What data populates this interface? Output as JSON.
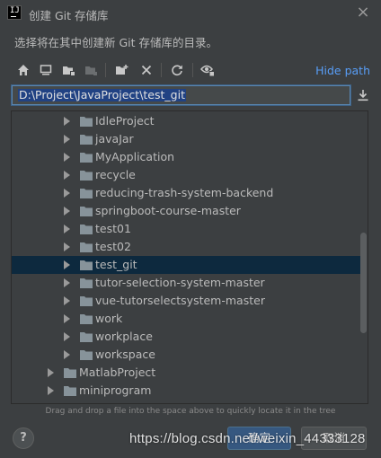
{
  "window": {
    "title": "创建 Git 存储库",
    "close_icon": "×"
  },
  "dialog": {
    "subtitle": "选择将在其中创建新 Git 存储库的目录。"
  },
  "toolbar": {
    "icons": [
      "home-icon",
      "desktop-icon",
      "project-folder-icon",
      "module-folder-icon",
      "new-folder-icon",
      "delete-icon",
      "refresh-icon",
      "show-hidden-icon"
    ],
    "hide_path_label": "Hide path"
  },
  "path": {
    "value": "D:\\Project\\JavaProject\\test_git"
  },
  "tree": {
    "nested_items": [
      {
        "label": "IdleProject",
        "selected": false
      },
      {
        "label": "javaJar",
        "selected": false
      },
      {
        "label": "MyApplication",
        "selected": false
      },
      {
        "label": "recycle",
        "selected": false
      },
      {
        "label": "reducing-trash-system-backend",
        "selected": false
      },
      {
        "label": "springboot-course-master",
        "selected": false
      },
      {
        "label": "test01",
        "selected": false
      },
      {
        "label": "test02",
        "selected": false
      },
      {
        "label": "test_git",
        "selected": true
      },
      {
        "label": "tutor-selection-system-master",
        "selected": false
      },
      {
        "label": "vue-tutorselectsystem-master",
        "selected": false
      },
      {
        "label": "work",
        "selected": false
      },
      {
        "label": "workplace",
        "selected": false
      },
      {
        "label": "workspace",
        "selected": false
      }
    ],
    "top_items": [
      {
        "label": "MatlabProject"
      },
      {
        "label": "miniprogram"
      }
    ]
  },
  "hint": "Drag and drop a file into the space above to quickly locate it in the tree",
  "buttons": {
    "help": "?",
    "ok": "确定",
    "cancel": "取消"
  },
  "watermark": "https://blog.csdn.net/weixin_44333128",
  "colors": {
    "background": "#3c3f41",
    "selection": "#0d293e",
    "link": "#589df6",
    "folder": "#87939a",
    "primary_button": "#365880"
  }
}
